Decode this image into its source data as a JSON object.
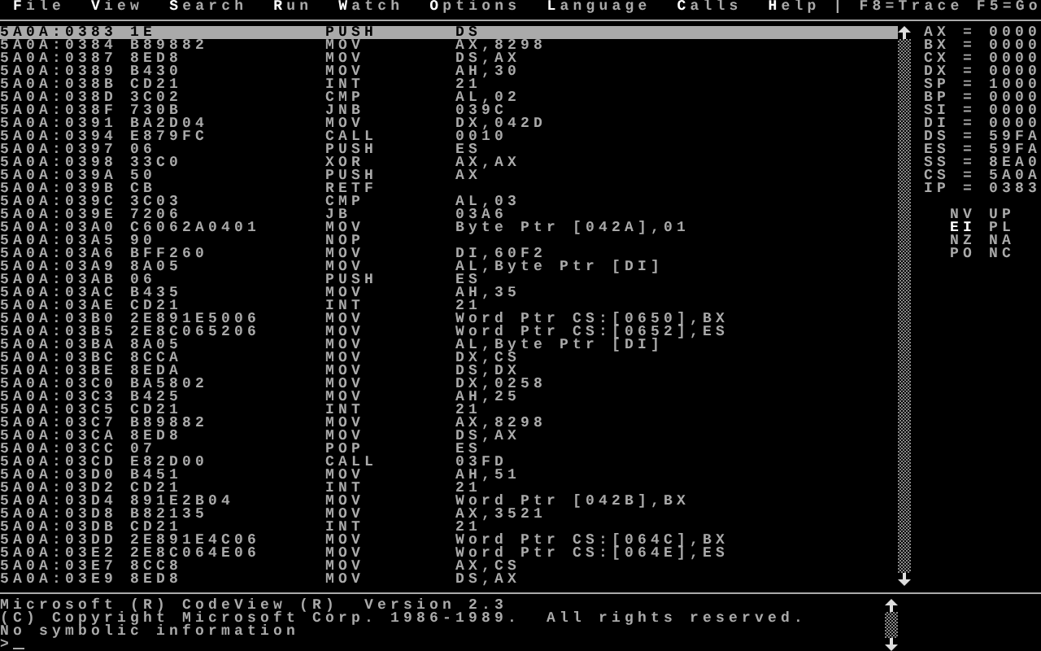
{
  "menu": [
    {
      "label": "File"
    },
    {
      "label": "View"
    },
    {
      "label": "Search"
    },
    {
      "label": "Run"
    },
    {
      "label": "Watch"
    },
    {
      "label": "Options"
    },
    {
      "label": "Language"
    },
    {
      "label": "Calls"
    },
    {
      "label": "Help"
    }
  ],
  "menu_separator": "|",
  "function_keys": [
    "F8=Trace",
    "F5=Go"
  ],
  "code_rows": [
    {
      "address": "5A0A:0383",
      "bytes": "1E",
      "mnemonic": "PUSH",
      "operands": "DS",
      "selected": true
    },
    {
      "address": "5A0A:0384",
      "bytes": "B89882",
      "mnemonic": "MOV",
      "operands": "AX,8298",
      "selected": false
    },
    {
      "address": "5A0A:0387",
      "bytes": "8ED8",
      "mnemonic": "MOV",
      "operands": "DS,AX",
      "selected": false
    },
    {
      "address": "5A0A:0389",
      "bytes": "B430",
      "mnemonic": "MOV",
      "operands": "AH,30",
      "selected": false
    },
    {
      "address": "5A0A:038B",
      "bytes": "CD21",
      "mnemonic": "INT",
      "operands": "21",
      "selected": false
    },
    {
      "address": "5A0A:038D",
      "bytes": "3C02",
      "mnemonic": "CMP",
      "operands": "AL,02",
      "selected": false
    },
    {
      "address": "5A0A:038F",
      "bytes": "730B",
      "mnemonic": "JNB",
      "operands": "039C",
      "selected": false
    },
    {
      "address": "5A0A:0391",
      "bytes": "BA2D04",
      "mnemonic": "MOV",
      "operands": "DX,042D",
      "selected": false
    },
    {
      "address": "5A0A:0394",
      "bytes": "E879FC",
      "mnemonic": "CALL",
      "operands": "0010",
      "selected": false
    },
    {
      "address": "5A0A:0397",
      "bytes": "06",
      "mnemonic": "PUSH",
      "operands": "ES",
      "selected": false
    },
    {
      "address": "5A0A:0398",
      "bytes": "33C0",
      "mnemonic": "XOR",
      "operands": "AX,AX",
      "selected": false
    },
    {
      "address": "5A0A:039A",
      "bytes": "50",
      "mnemonic": "PUSH",
      "operands": "AX",
      "selected": false
    },
    {
      "address": "5A0A:039B",
      "bytes": "CB",
      "mnemonic": "RETF",
      "operands": "",
      "selected": false
    },
    {
      "address": "5A0A:039C",
      "bytes": "3C03",
      "mnemonic": "CMP",
      "operands": "AL,03",
      "selected": false
    },
    {
      "address": "5A0A:039E",
      "bytes": "7206",
      "mnemonic": "JB",
      "operands": "03A6",
      "selected": false
    },
    {
      "address": "5A0A:03A0",
      "bytes": "C6062A0401",
      "mnemonic": "MOV",
      "operands": "Byte Ptr [042A],01",
      "selected": false
    },
    {
      "address": "5A0A:03A5",
      "bytes": "90",
      "mnemonic": "NOP",
      "operands": "",
      "selected": false
    },
    {
      "address": "5A0A:03A6",
      "bytes": "BFF260",
      "mnemonic": "MOV",
      "operands": "DI,60F2",
      "selected": false
    },
    {
      "address": "5A0A:03A9",
      "bytes": "8A05",
      "mnemonic": "MOV",
      "operands": "AL,Byte Ptr [DI]",
      "selected": false
    },
    {
      "address": "5A0A:03AB",
      "bytes": "06",
      "mnemonic": "PUSH",
      "operands": "ES",
      "selected": false
    },
    {
      "address": "5A0A:03AC",
      "bytes": "B435",
      "mnemonic": "MOV",
      "operands": "AH,35",
      "selected": false
    },
    {
      "address": "5A0A:03AE",
      "bytes": "CD21",
      "mnemonic": "INT",
      "operands": "21",
      "selected": false
    },
    {
      "address": "5A0A:03B0",
      "bytes": "2E891E5006",
      "mnemonic": "MOV",
      "operands": "Word Ptr CS:[0650],BX",
      "selected": false
    },
    {
      "address": "5A0A:03B5",
      "bytes": "2E8C065206",
      "mnemonic": "MOV",
      "operands": "Word Ptr CS:[0652],ES",
      "selected": false
    },
    {
      "address": "5A0A:03BA",
      "bytes": "8A05",
      "mnemonic": "MOV",
      "operands": "AL,Byte Ptr [DI]",
      "selected": false
    },
    {
      "address": "5A0A:03BC",
      "bytes": "8CCA",
      "mnemonic": "MOV",
      "operands": "DX,CS",
      "selected": false
    },
    {
      "address": "5A0A:03BE",
      "bytes": "8EDA",
      "mnemonic": "MOV",
      "operands": "DS,DX",
      "selected": false
    },
    {
      "address": "5A0A:03C0",
      "bytes": "BA5802",
      "mnemonic": "MOV",
      "operands": "DX,0258",
      "selected": false
    },
    {
      "address": "5A0A:03C3",
      "bytes": "B425",
      "mnemonic": "MOV",
      "operands": "AH,25",
      "selected": false
    },
    {
      "address": "5A0A:03C5",
      "bytes": "CD21",
      "mnemonic": "INT",
      "operands": "21",
      "selected": false
    },
    {
      "address": "5A0A:03C7",
      "bytes": "B89882",
      "mnemonic": "MOV",
      "operands": "AX,8298",
      "selected": false
    },
    {
      "address": "5A0A:03CA",
      "bytes": "8ED8",
      "mnemonic": "MOV",
      "operands": "DS,AX",
      "selected": false
    },
    {
      "address": "5A0A:03CC",
      "bytes": "07",
      "mnemonic": "POP",
      "operands": "ES",
      "selected": false
    },
    {
      "address": "5A0A:03CD",
      "bytes": "E82D00",
      "mnemonic": "CALL",
      "operands": "03FD",
      "selected": false
    },
    {
      "address": "5A0A:03D0",
      "bytes": "B451",
      "mnemonic": "MOV",
      "operands": "AH,51",
      "selected": false
    },
    {
      "address": "5A0A:03D2",
      "bytes": "CD21",
      "mnemonic": "INT",
      "operands": "21",
      "selected": false
    },
    {
      "address": "5A0A:03D4",
      "bytes": "891E2B04",
      "mnemonic": "MOV",
      "operands": "Word Ptr [042B],BX",
      "selected": false
    },
    {
      "address": "5A0A:03D8",
      "bytes": "B82135",
      "mnemonic": "MOV",
      "operands": "AX,3521",
      "selected": false
    },
    {
      "address": "5A0A:03DB",
      "bytes": "CD21",
      "mnemonic": "INT",
      "operands": "21",
      "selected": false
    },
    {
      "address": "5A0A:03DD",
      "bytes": "2E891E4C06",
      "mnemonic": "MOV",
      "operands": "Word Ptr CS:[064C],BX",
      "selected": false
    },
    {
      "address": "5A0A:03E2",
      "bytes": "2E8C064E06",
      "mnemonic": "MOV",
      "operands": "Word Ptr CS:[064E],ES",
      "selected": false
    },
    {
      "address": "5A0A:03E7",
      "bytes": "8CC8",
      "mnemonic": "MOV",
      "operands": "AX,CS",
      "selected": false
    },
    {
      "address": "5A0A:03E9",
      "bytes": "8ED8",
      "mnemonic": "MOV",
      "operands": "DS,AX",
      "selected": false
    }
  ],
  "registers": [
    {
      "name": "AX",
      "equals": "=",
      "value": "0000"
    },
    {
      "name": "BX",
      "equals": "=",
      "value": "0000"
    },
    {
      "name": "CX",
      "equals": "=",
      "value": "0000"
    },
    {
      "name": "DX",
      "equals": "=",
      "value": "0000"
    },
    {
      "name": "SP",
      "equals": "=",
      "value": "1000"
    },
    {
      "name": "BP",
      "equals": "=",
      "value": "0000"
    },
    {
      "name": "SI",
      "equals": "=",
      "value": "0000"
    },
    {
      "name": "DI",
      "equals": "=",
      "value": "0000"
    },
    {
      "name": "DS",
      "equals": "=",
      "value": "59FA"
    },
    {
      "name": "ES",
      "equals": "=",
      "value": "59FA"
    },
    {
      "name": "SS",
      "equals": "=",
      "value": "8EA0"
    },
    {
      "name": "CS",
      "equals": "=",
      "value": "5A0A"
    },
    {
      "name": "IP",
      "equals": "=",
      "value": "0383"
    }
  ],
  "flags": [
    {
      "label": "NV",
      "highlighted": false
    },
    {
      "label": "UP",
      "highlighted": false
    },
    {
      "label": "EI",
      "highlighted": true
    },
    {
      "label": "PL",
      "highlighted": false
    },
    {
      "label": "NZ",
      "highlighted": false
    },
    {
      "label": "NA",
      "highlighted": false
    },
    {
      "label": "PO",
      "highlighted": false
    },
    {
      "label": "NC",
      "highlighted": false
    }
  ],
  "command_output": [
    "Microsoft (R) CodeView (R)  Version 2.3",
    "(C) Copyright Microsoft Corp. 1986-1989.  All rights reserved.",
    "No symbolic information"
  ],
  "prompt": ">"
}
